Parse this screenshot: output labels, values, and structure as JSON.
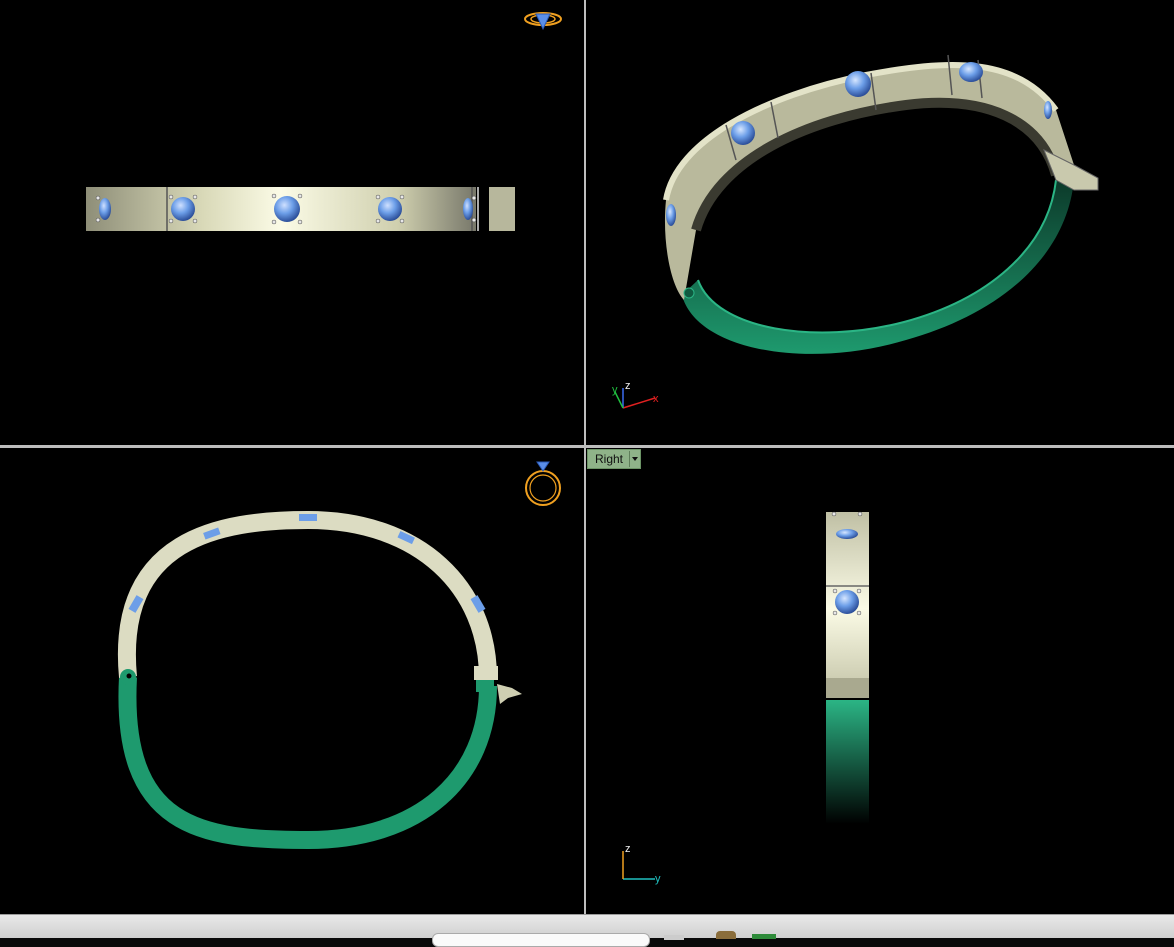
{
  "viewports": {
    "front": {
      "name": "front-view"
    },
    "perspective": {
      "name": "perspective-view",
      "axis_labels": {
        "x": "x",
        "y": "y",
        "z": "z"
      }
    },
    "top": {
      "name": "top-view"
    },
    "right": {
      "name": "right-view",
      "label": "Right",
      "axis_labels": {
        "y": "y",
        "z": "z"
      }
    }
  },
  "colors": {
    "background": "#000000",
    "metal": "#d8d8bc",
    "metal_shade": "#8a8a74",
    "hinge_green": "#1e9a6e",
    "gem_blue": "#6c9ee8",
    "gizmo_orange": "#f0a020",
    "view_label_bg": "#8fb389"
  },
  "icons": {
    "ring_gizmo_front": "ring-gizmo-icon",
    "ring_gizmo_top": "ring-top-gizmo-icon",
    "view_dropdown": "chevron-down-icon"
  }
}
